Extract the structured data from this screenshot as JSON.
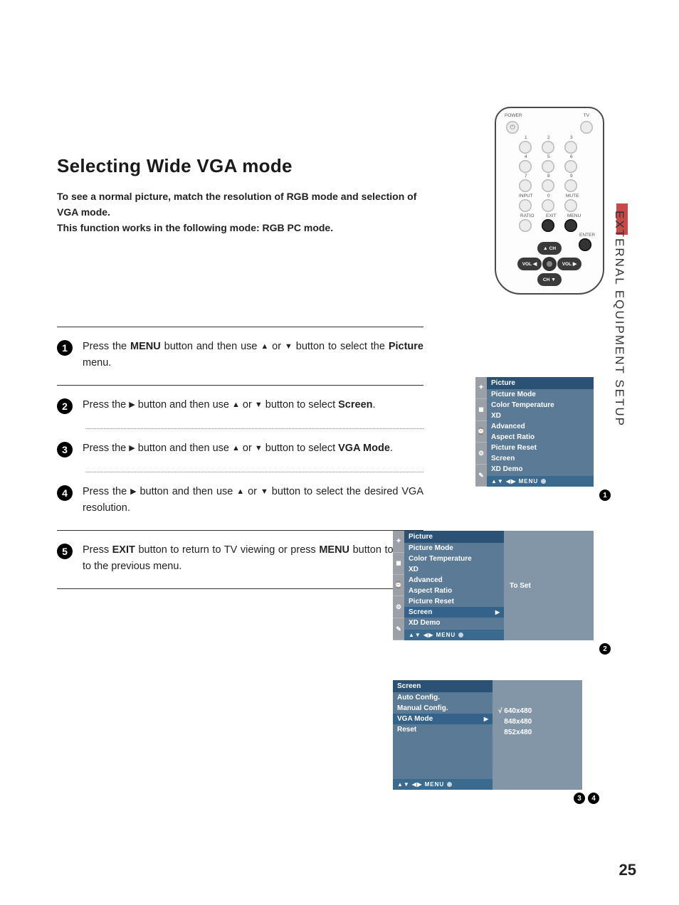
{
  "section_tab": "EXTERNAL EQUIPMENT SETUP",
  "title": "Selecting Wide VGA mode",
  "intro_line1": "To see a normal picture, match the resolution of RGB mode and selection of VGA mode.",
  "intro_line2": "This function works in the following mode: RGB PC mode.",
  "glyphs": {
    "up": "▲",
    "down": "▼",
    "right": "▶",
    "left": "◀",
    "check": "√"
  },
  "steps": {
    "s1": {
      "pre": "Press the ",
      "b1": "MENU",
      "mid1": " button and then use ",
      "mid2": " or ",
      "mid3": " button to select the ",
      "b2": "Picture",
      "post": " menu."
    },
    "s2": {
      "pre": "Press the ",
      "mid1": " button and then use ",
      "mid2": " or ",
      "mid3": " button to select ",
      "b1": "Screen",
      "post": "."
    },
    "s3": {
      "pre": "Press the ",
      "mid1": " button and then use ",
      "mid2": " or ",
      "mid3": " button to select ",
      "b1": "VGA Mode",
      "post": "."
    },
    "s4": {
      "pre": "Press the ",
      "mid1": " button and then use ",
      "mid2": " or ",
      "mid3": " button to select the desired VGA resolution."
    },
    "s5": {
      "pre": "Press ",
      "b1": "EXIT",
      "mid1": " button to return to TV viewing or press ",
      "b2": "MENU",
      "post": " button to return to the previous menu."
    }
  },
  "remote": {
    "labels": {
      "power": "POWER",
      "tv": "TV",
      "input": "INPUT",
      "mute": "MUTE",
      "ratio": "RATIO",
      "exit": "EXIT",
      "menu": "MENU",
      "enter": "ENTER",
      "ch": "CH",
      "vol": "VOL"
    },
    "digits": [
      "1",
      "2",
      "3",
      "4",
      "5",
      "6",
      "7",
      "8",
      "9",
      "0"
    ]
  },
  "osd": {
    "picture_hdr": "Picture",
    "picture_items": [
      "Picture Mode",
      "Color Temperature",
      "XD",
      "Advanced",
      "Aspect Ratio",
      "Picture Reset",
      "Screen",
      "XD Demo"
    ],
    "footer": "▲▼  ◀▶      MENU",
    "to_set": "To Set",
    "screen_hdr": "Screen",
    "screen_items": [
      "Auto Config.",
      "Manual Config.",
      "VGA Mode",
      "Reset"
    ],
    "vga_options": [
      "640x480",
      "848x480",
      "852x480"
    ]
  },
  "page_number": "25",
  "callouts": {
    "c1": "1",
    "c2": "2",
    "c3": "3",
    "c4": "4"
  }
}
